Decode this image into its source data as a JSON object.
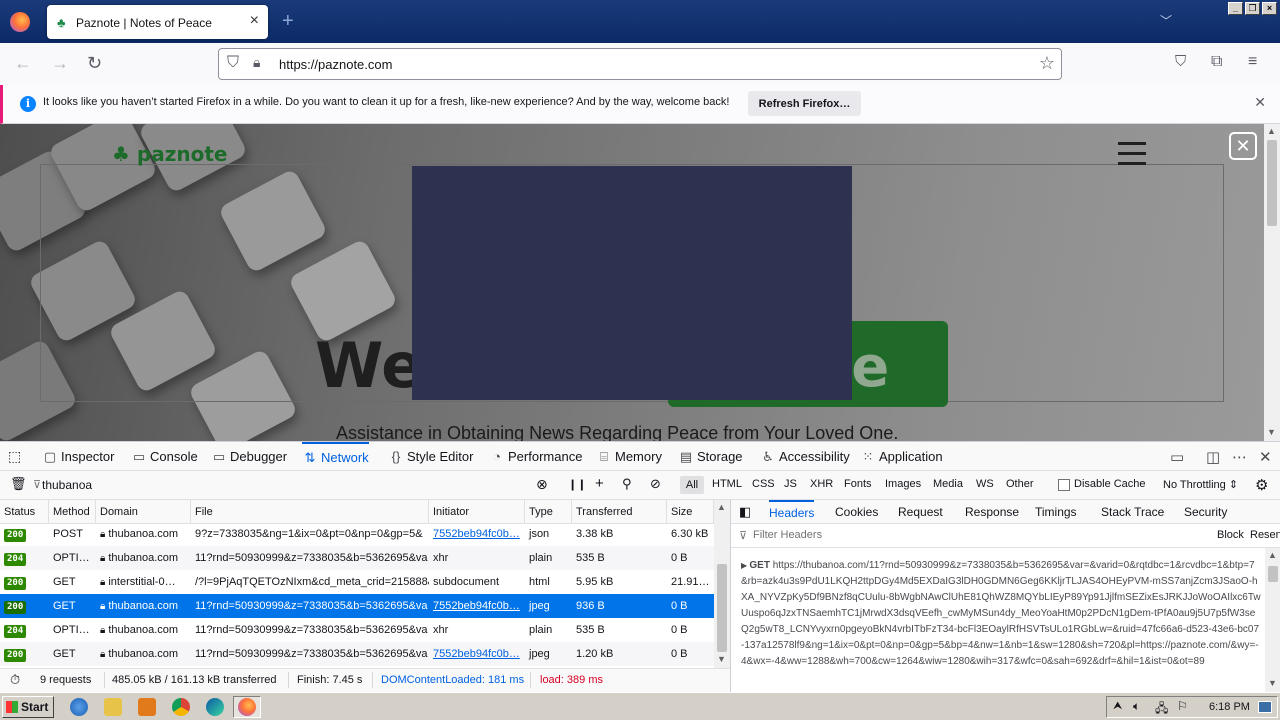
{
  "browser": {
    "tab_title": "Paznote | Notes of Peace",
    "url": "https://paznote.com",
    "notification_text": "It looks like you haven’t started Firefox in a while. Do you want to clean it up for a fresh, like-new experience? And by the way, welcome back!",
    "notification_button": "Refresh Firefox…"
  },
  "page": {
    "logo_text": "paznote",
    "hero_title": "Wel",
    "hero_title_right": "ote",
    "hero_subtitle": "Assistance in Obtaining News Regarding Peace from Your Loved One."
  },
  "devtools": {
    "tabs": [
      {
        "label": "Inspector",
        "icon": "inspector-icon"
      },
      {
        "label": "Console",
        "icon": "console-icon"
      },
      {
        "label": "Debugger",
        "icon": "debugger-icon"
      },
      {
        "label": "Network",
        "icon": "network-icon"
      },
      {
        "label": "Style Editor",
        "icon": "style-editor-icon"
      },
      {
        "label": "Performance",
        "icon": "performance-icon"
      },
      {
        "label": "Memory",
        "icon": "memory-icon"
      },
      {
        "label": "Storage",
        "icon": "storage-icon"
      },
      {
        "label": "Accessibility",
        "icon": "accessibility-icon"
      },
      {
        "label": "Application",
        "icon": "application-icon"
      }
    ],
    "active_tab": "Network",
    "filter_value": "thubanoa",
    "type_filters": [
      "All",
      "HTML",
      "CSS",
      "JS",
      "XHR",
      "Fonts",
      "Images",
      "Media",
      "WS",
      "Other"
    ],
    "disable_cache_label": "Disable Cache",
    "throttling": "No Throttling ⇕",
    "columns": [
      "Status",
      "Method",
      "Domain",
      "File",
      "Initiator",
      "Type",
      "Transferred",
      "Size"
    ],
    "rows": [
      {
        "status": "200",
        "method": "POST",
        "domain": "thubanoa.com",
        "file": "9?z=7338035&ng=1&ix=0&pt=0&np=0&gp=5&",
        "initiator": "7552beb94fc0b…",
        "initiator_link": true,
        "type": "json",
        "transferred": "3.38 kB",
        "size": "6.30 kB"
      },
      {
        "status": "204",
        "method": "OPTI…",
        "domain": "thubanoa.com",
        "file": "11?rnd=50930999&z=7338035&b=5362695&va",
        "initiator": "xhr",
        "initiator_link": false,
        "type": "plain",
        "transferred": "535 B",
        "size": "0 B"
      },
      {
        "status": "200",
        "method": "GET",
        "domain": "interstitial-0…",
        "file": "/?l=9PjAqTQETOzNIxm&cd_meta_crid=215888&i",
        "initiator": "subdocument",
        "initiator_link": false,
        "type": "html",
        "transferred": "5.95 kB",
        "size": "21.91…"
      },
      {
        "status": "200",
        "method": "GET",
        "domain": "thubanoa.com",
        "file": "11?rnd=50930999&z=7338035&b=5362695&va",
        "initiator": "7552beb94fc0b…",
        "initiator_link": true,
        "type": "jpeg",
        "transferred": "936 B",
        "size": "0 B"
      },
      {
        "status": "204",
        "method": "OPTI…",
        "domain": "thubanoa.com",
        "file": "11?rnd=50930999&z=7338035&b=5362695&va",
        "initiator": "xhr",
        "initiator_link": false,
        "type": "plain",
        "transferred": "535 B",
        "size": "0 B"
      },
      {
        "status": "200",
        "method": "GET",
        "domain": "thubanoa.com",
        "file": "11?rnd=50930999&z=7338035&b=5362695&va",
        "initiator": "7552beb94fc0b…",
        "initiator_link": true,
        "type": "jpeg",
        "transferred": "1.20 kB",
        "size": "0 B"
      }
    ],
    "selected_row": 3,
    "summary": {
      "requests": "9 requests",
      "transferred": "485.05 kB / 161.13 kB transferred",
      "finish": "Finish: 7.45 s",
      "dom_loaded": "DOMContentLoaded: 181 ms",
      "load": "load: 389 ms"
    },
    "detail_tabs": [
      "Headers",
      "Cookies",
      "Request",
      "Response",
      "Timings",
      "Stack Trace",
      "Security"
    ],
    "detail_active": "Headers",
    "filter_headers_placeholder": "Filter Headers",
    "block_label": "Block",
    "resend_label": "Resend",
    "request_method": "GET",
    "request_url": "https://thubanoa.com/11?rnd=50930999&z=7338035&b=5362695&var=&varid=0&rqtdbc=1&rcvdbc=1&btp=7&rb=azk4u3s9PdU1LKQH2ttpDGy4Md5EXDaIG3lDH0GDMN6Geg6KKljrTLJAS4OHEyPVM-mSS7anjZcm3JSaoO-hXA_NYVZpKy5Df9BNzf8qCUulu-8bWgbNAwClUhE81QhWZ8MQYbLIEyP89Yp91JjlfmSEZixEsJRKJJoWoOAIlxc6TwUuspo6qJzxTNSaemhTC1jMrwdX3dsqVEefh_cwMyMSun4dy_MeoYoaHtM0p2PDcN1gDem-tPfA0au9j5U7p5fW3seQ2g5wT8_LCNYvyxrn0pgeyoBkN4vrbITbFzT34-bcFl3EOaylRfHSVTsULo1RGbLw=&ruid=47fc66a6-d523-43e6-bc07-137a12578lf9&ng=1&ix=0&pt=0&np=0&gp=5&bp=4&nw=1&nb=1&sw=1280&sh=720&pl=https://paznote.com/&wy=-4&wx=-4&ww=1288&wh=700&cw=1264&wiw=1280&wih=317&wfc=0&sah=692&drf=&hil=1&ist=0&ot=89"
  },
  "taskbar": {
    "start_label": "Start",
    "clock": "6:18 PM"
  },
  "colors": {
    "accent": "#0061e0",
    "selected_row": "#0074e8",
    "status_ok": "#2d8a00",
    "overlay_panel": "#2e3150",
    "brand_green": "#1f6a28"
  }
}
